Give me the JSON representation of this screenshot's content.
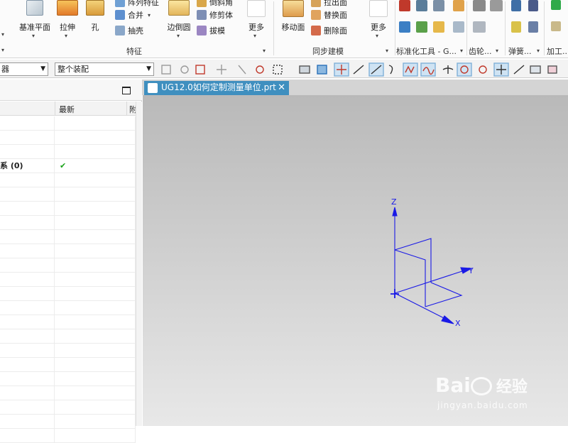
{
  "ribbon": {
    "datum_plane": "基准平面",
    "extrude": "拉伸",
    "hole": "孔",
    "pattern_feature": "阵列特征",
    "unite": "合并",
    "shell": "抽壳",
    "edge_blend": "边倒圆",
    "chamfer": "倒斜角",
    "trim_body": "修剪体",
    "draft": "拔模",
    "more_1": "更多",
    "feature_group": "特征",
    "move_face": "移动面",
    "pull_face": "拉出面",
    "replace_face": "替换面",
    "delete_face": "删除面",
    "more_2": "更多",
    "sync_group": "同步建模",
    "std_tools_group": "标准化工具 - G...",
    "gear_group": "齿轮...",
    "spring_group": "弹簧...",
    "machining_group": "加工..."
  },
  "toolbar": {
    "filter_value": "器",
    "assembly_value": "整个装配"
  },
  "navigator": {
    "col_latest": "最新",
    "col_extra": "附",
    "rows": [
      "",
      "",
      "",
      "系 (0)",
      "",
      "",
      "",
      "",
      "",
      "",
      "",
      "",
      "",
      "",
      "",
      "",
      "",
      "",
      "",
      "",
      "",
      "",
      ""
    ],
    "checked_row_mark": "✔"
  },
  "tab": {
    "title": "UG12.0如何定制测量单位.prt",
    "close": "✕"
  },
  "axes": {
    "z": "Z",
    "y": "Y",
    "x": "X"
  },
  "watermark": {
    "brand": "Bai",
    "brand_suffix": "经验",
    "url": "jingyan.baidu.com"
  },
  "colors": {
    "accent_tab": "#3f8fbf",
    "triad": "#0000e0"
  }
}
